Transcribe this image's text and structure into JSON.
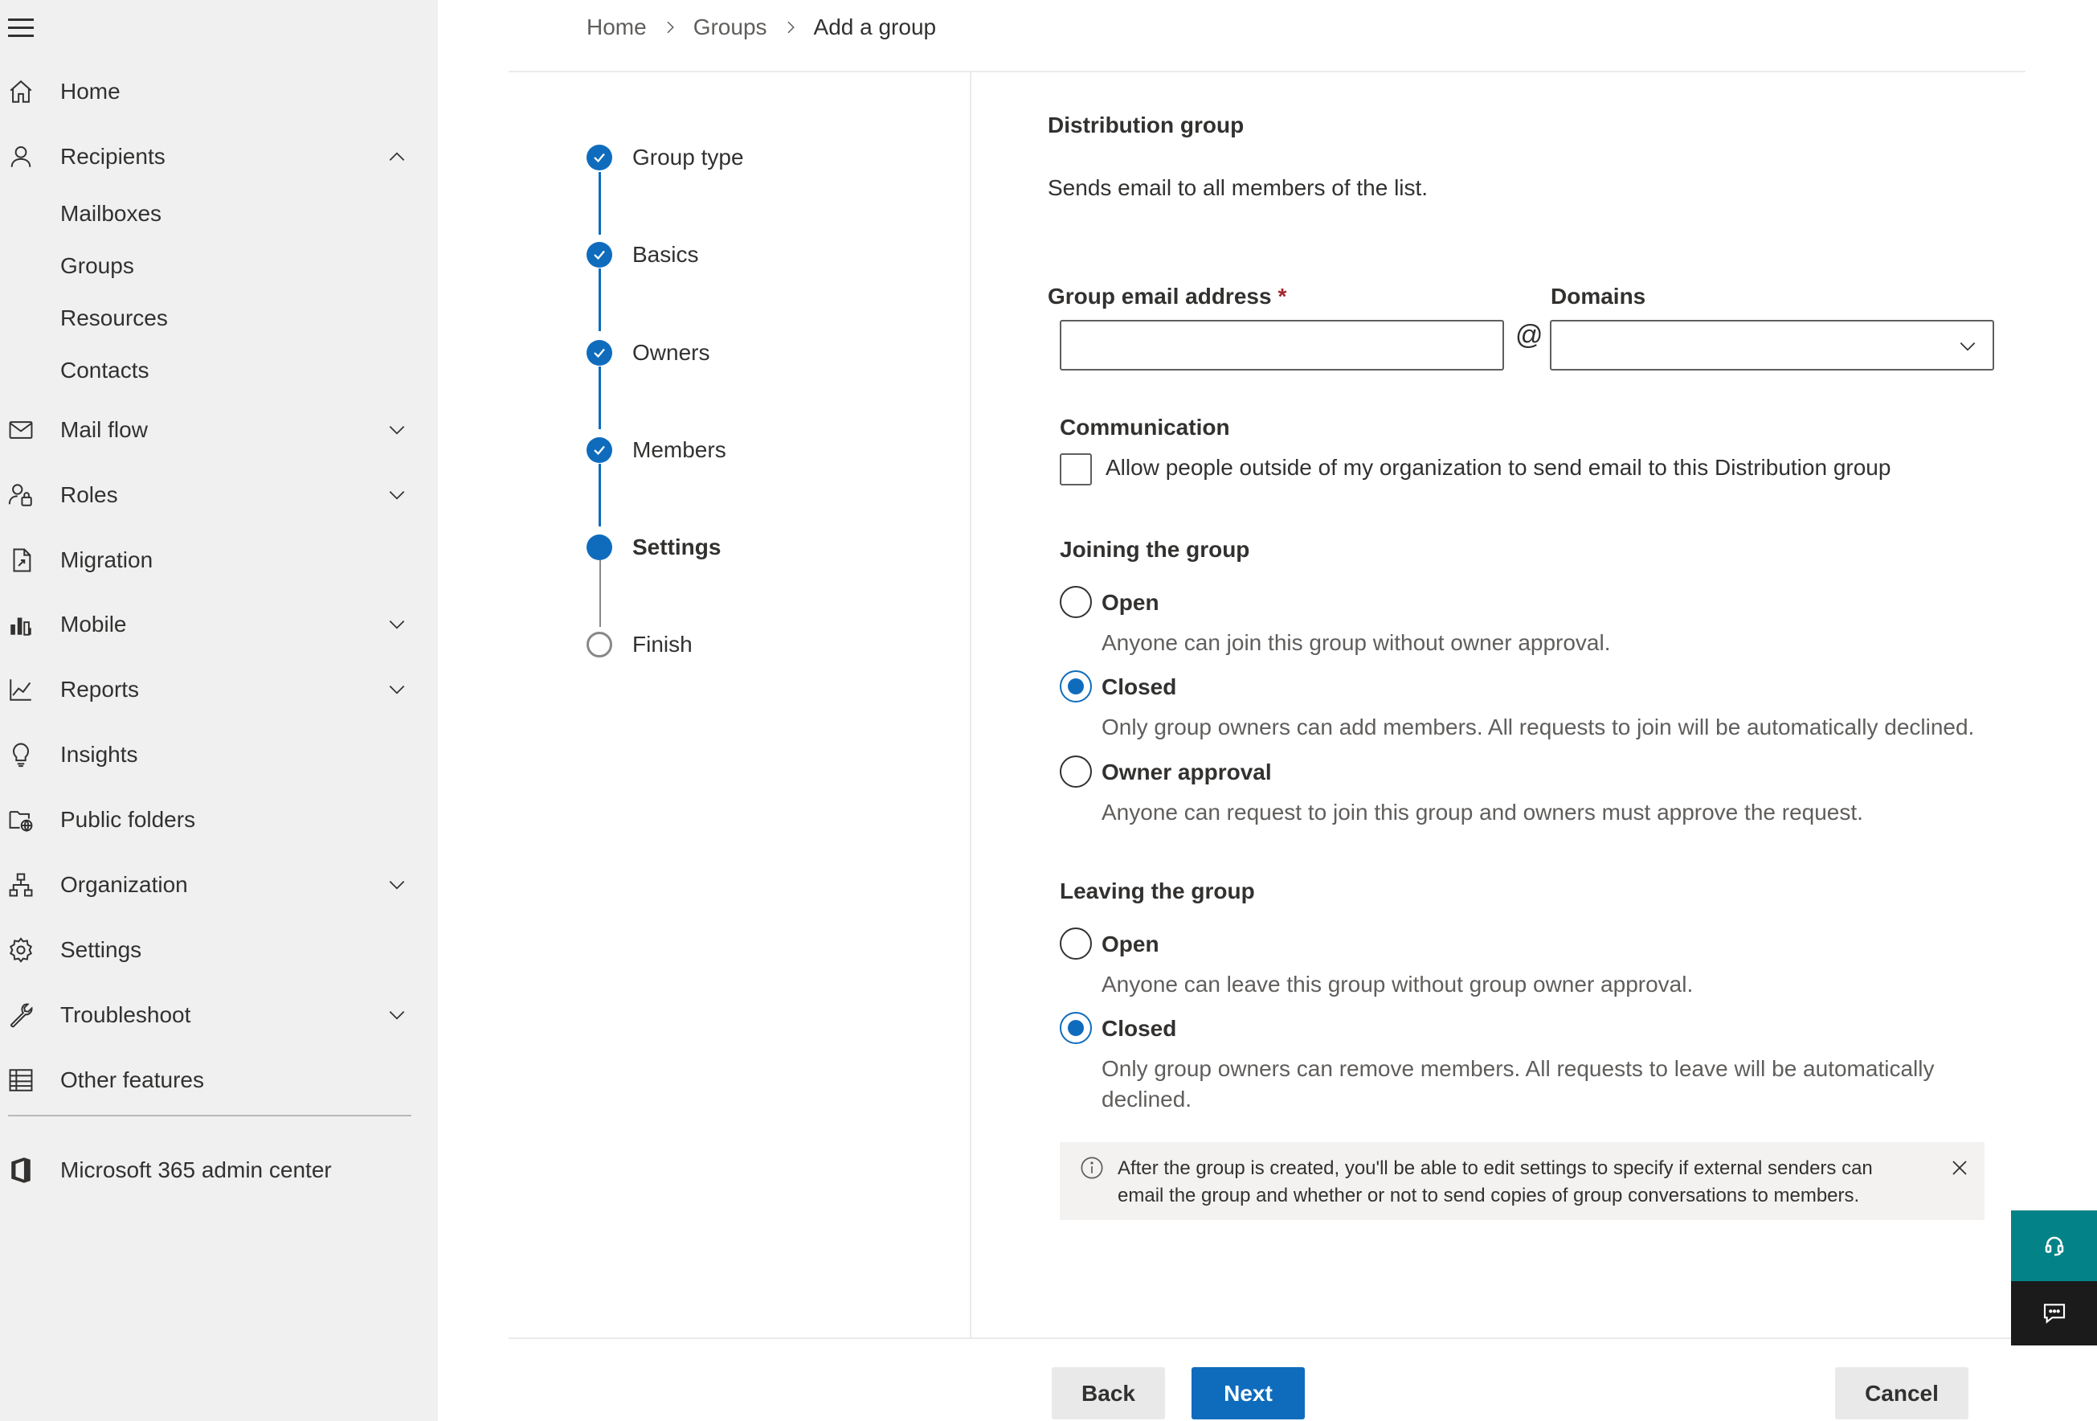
{
  "nav": {
    "items": [
      {
        "label": "Home",
        "icon": "home-icon"
      },
      {
        "label": "Recipients",
        "icon": "person-icon",
        "expanded": true,
        "children": [
          "Mailboxes",
          "Groups",
          "Resources",
          "Contacts"
        ]
      },
      {
        "label": "Mail flow",
        "icon": "mail-icon"
      },
      {
        "label": "Roles",
        "icon": "roles-icon"
      },
      {
        "label": "Migration",
        "icon": "migration-icon"
      },
      {
        "label": "Mobile",
        "icon": "mobile-icon"
      },
      {
        "label": "Reports",
        "icon": "reports-icon"
      },
      {
        "label": "Insights",
        "icon": "lightbulb-icon"
      },
      {
        "label": "Public folders",
        "icon": "public-folders-icon"
      },
      {
        "label": "Organization",
        "icon": "organization-icon"
      },
      {
        "label": "Settings",
        "icon": "gear-icon"
      },
      {
        "label": "Troubleshoot",
        "icon": "wrench-icon"
      },
      {
        "label": "Other features",
        "icon": "table-icon"
      }
    ],
    "admin_center": "Microsoft 365 admin center"
  },
  "breadcrumb": [
    "Home",
    "Groups",
    "Add a group"
  ],
  "steps": [
    {
      "label": "Group type",
      "state": "done"
    },
    {
      "label": "Basics",
      "state": "done"
    },
    {
      "label": "Owners",
      "state": "done"
    },
    {
      "label": "Members",
      "state": "done"
    },
    {
      "label": "Settings",
      "state": "current"
    },
    {
      "label": "Finish",
      "state": "todo"
    }
  ],
  "form": {
    "title": "Distribution group",
    "description": "Sends email to all members of the list.",
    "email_label": "Group email address",
    "required_mark": "*",
    "email_value": "",
    "at_sign": "@",
    "domains_label": "Domains",
    "domains_value": "",
    "communication_title": "Communication",
    "communication_checkbox": "Allow people outside of my organization to send email to this Distribution group",
    "communication_checked": false,
    "joining": {
      "title": "Joining the group",
      "selected": "Closed",
      "options": [
        {
          "label": "Open",
          "desc": "Anyone can join this group without owner approval."
        },
        {
          "label": "Closed",
          "desc": "Only group owners can add members. All requests to join will be automatically declined."
        },
        {
          "label": "Owner approval",
          "desc": "Anyone can request to join this group and owners must approve the request."
        }
      ]
    },
    "leaving": {
      "title": "Leaving the group",
      "selected": "Closed",
      "options": [
        {
          "label": "Open",
          "desc": "Anyone can leave this group without group owner approval."
        },
        {
          "label": "Closed",
          "desc_line1": "Only group owners can remove members. All requests to leave will be automatically",
          "desc_line2": "declined."
        }
      ]
    },
    "info": "After the group is created, you'll be able to edit settings to specify if external senders can email the group and whether or not to send copies of group conversations to members."
  },
  "buttons": {
    "back": "Back",
    "next": "Next",
    "cancel": "Cancel"
  },
  "colors": {
    "accent": "#0f6cbd",
    "nav_bg": "#f0f0f0",
    "help_bg": "#038387",
    "chat_bg": "#1b1b1b"
  }
}
